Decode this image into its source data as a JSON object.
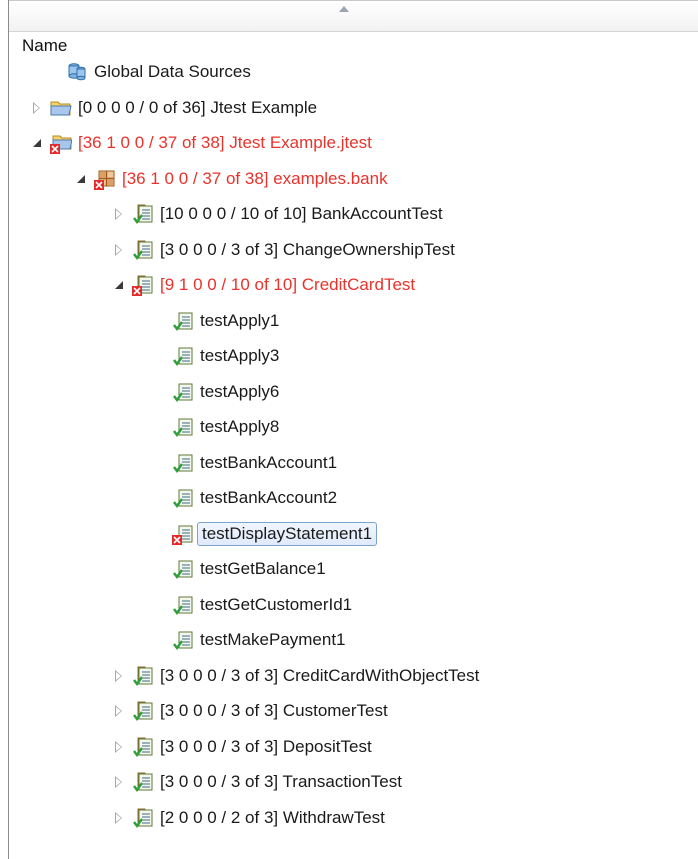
{
  "header": {
    "column_name": "Name"
  },
  "tree": [
    {
      "label": "Global Data Sources",
      "icon": "data-sources-icon",
      "state": "none",
      "status": "normal"
    },
    {
      "label": "[0 0 0 0 / 0 of 36]  Jtest Example",
      "icon": "folder-icon",
      "state": "collapsed",
      "status": "normal"
    },
    {
      "label": "[36 1 0 0 / 37 of 38]  Jtest Example.jtest",
      "icon": "folder-error-icon",
      "state": "expanded",
      "status": "failed"
    },
    {
      "label": "[36 1 0 0 / 37 of 38]  examples.bank",
      "icon": "package-error-icon",
      "state": "expanded",
      "status": "failed"
    },
    {
      "label": "[10 0 0 0 / 10 of 10]  BankAccountTest",
      "icon": "test-class-pass-icon",
      "state": "collapsed",
      "status": "normal"
    },
    {
      "label": "[3 0 0 0 / 3 of 3]  ChangeOwnershipTest",
      "icon": "test-class-pass-icon",
      "state": "collapsed",
      "status": "normal"
    },
    {
      "label": "[9 1 0 0 / 10 of 10]  CreditCardTest",
      "icon": "test-class-fail-icon",
      "state": "expanded",
      "status": "failed"
    },
    {
      "label": "testApply1",
      "icon": "test-method-pass-icon",
      "state": "none",
      "status": "normal"
    },
    {
      "label": "testApply3",
      "icon": "test-method-pass-icon",
      "state": "none",
      "status": "normal"
    },
    {
      "label": "testApply6",
      "icon": "test-method-pass-icon",
      "state": "none",
      "status": "normal"
    },
    {
      "label": "testApply8",
      "icon": "test-method-pass-icon",
      "state": "none",
      "status": "normal"
    },
    {
      "label": "testBankAccount1",
      "icon": "test-method-pass-icon",
      "state": "none",
      "status": "normal"
    },
    {
      "label": "testBankAccount2",
      "icon": "test-method-pass-icon",
      "state": "none",
      "status": "normal"
    },
    {
      "label": "testDisplayStatement1",
      "icon": "test-method-fail-icon",
      "state": "none",
      "status": "selected"
    },
    {
      "label": "testGetBalance1",
      "icon": "test-method-pass-icon",
      "state": "none",
      "status": "normal"
    },
    {
      "label": "testGetCustomerId1",
      "icon": "test-method-pass-icon",
      "state": "none",
      "status": "normal"
    },
    {
      "label": "testMakePayment1",
      "icon": "test-method-pass-icon",
      "state": "none",
      "status": "normal"
    },
    {
      "label": "[3 0 0 0 / 3 of 3]  CreditCardWithObjectTest",
      "icon": "test-class-pass-icon",
      "state": "collapsed",
      "status": "normal"
    },
    {
      "label": "[3 0 0 0 / 3 of 3]  CustomerTest",
      "icon": "test-class-pass-icon",
      "state": "collapsed",
      "status": "normal"
    },
    {
      "label": "[3 0 0 0 / 3 of 3]  DepositTest",
      "icon": "test-class-pass-icon",
      "state": "collapsed",
      "status": "normal"
    },
    {
      "label": "[3 0 0 0 / 3 of 3]  TransactionTest",
      "icon": "test-class-pass-icon",
      "state": "collapsed",
      "status": "normal"
    },
    {
      "label": "[2 0 0 0 / 2 of 3]  WithdrawTest",
      "icon": "test-class-pass-icon",
      "state": "collapsed",
      "status": "normal"
    }
  ],
  "colors": {
    "failed_text": "#e8332c",
    "pass_check": "#2e9e3a",
    "fail_x": "#e22a2a",
    "selection_border": "#7da2ce"
  }
}
